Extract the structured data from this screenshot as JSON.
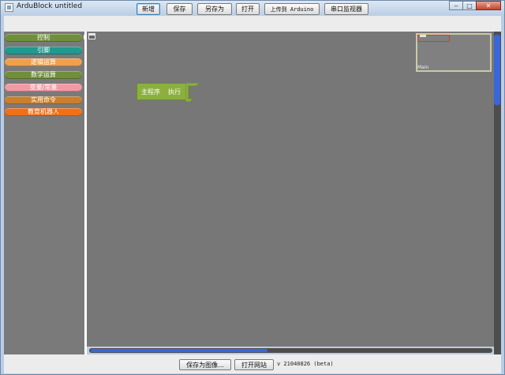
{
  "window": {
    "title": "ArduBlock untitled",
    "controls": {
      "minimize": "‒",
      "maximize": "□",
      "close": "✕"
    }
  },
  "toolbar": {
    "new": "新增",
    "save": "保存",
    "save_as": "另存为",
    "open": "打开",
    "upload": "上传到 Arduino",
    "serial_monitor": "串口监视器"
  },
  "categories": [
    {
      "label": "控制",
      "color": "#6f8f3a"
    },
    {
      "label": "引脚",
      "color": "#1f9a8f"
    },
    {
      "label": "逻辑运算",
      "color": "#f0a04b"
    },
    {
      "label": "数学运算",
      "color": "#6f8f3a"
    },
    {
      "label": "变量/常量",
      "color": "#f29aa3"
    },
    {
      "label": "实用命令",
      "color": "#c87f2e"
    },
    {
      "label": "教育机器人",
      "color": "#f36f14"
    }
  ],
  "canvas": {
    "block": {
      "label": "主程序",
      "sublabel": "执行"
    },
    "minimap_label": "Main"
  },
  "bottom": {
    "save_image": "保存为图像...",
    "open_website": "打开网站",
    "version": "v 21040826 (beta)"
  }
}
